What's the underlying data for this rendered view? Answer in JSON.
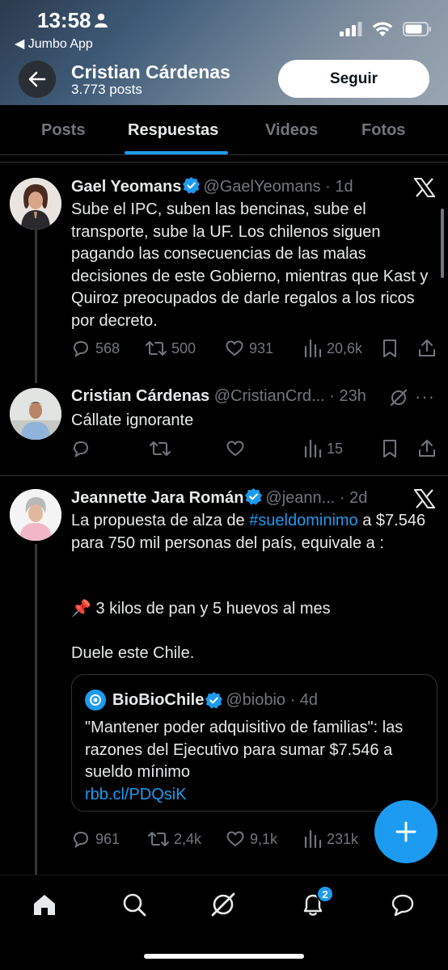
{
  "status_bar": {
    "time": "13:58",
    "back_app": "◀ Jumbo App"
  },
  "profile": {
    "name": "Cristian Cárdenas",
    "posts": "3.773 posts",
    "follow_label": "Seguir"
  },
  "tabs": [
    {
      "label": "Posts"
    },
    {
      "label": "Respuestas"
    },
    {
      "label": "Videos"
    },
    {
      "label": "Fotos"
    }
  ],
  "tweets": [
    {
      "name": "Gael Yeomans",
      "handle": "@GaelYeomans · 1d",
      "text": "Sube el IPC, suben las bencinas, sube el transporte, sube la UF. Los chilenos siguen pagando las consecuencias de las malas decisiones de este Gobierno, mientras que Kast y Quiroz preocupados de darle regalos a los ricos por decreto.",
      "replies": "568",
      "reposts": "500",
      "likes": "931",
      "views": "20,6k"
    },
    {
      "name": "Cristian Cárdenas",
      "handle": "@CristianCrd... · 23h",
      "text": "Cállate ignorante",
      "replies": "",
      "reposts": "",
      "likes": "",
      "views": "15"
    },
    {
      "name": "Jeannette Jara Román",
      "handle": "@jeann... · 2d",
      "text_before": "La propuesta de alza de ",
      "hashtag": "#sueldominimo",
      "text_after": " a $7.546 para 750 mil personas del país, equivale a :",
      "line2": "📌 3 kilos de pan y 5 huevos al mes",
      "line3": "Duele este Chile.",
      "replies": "961",
      "reposts": "2,4k",
      "likes": "9,1k",
      "views": "231k"
    }
  ],
  "quote": {
    "name": "BioBioChile",
    "handle": "@biobio · 4d",
    "text": "\"Mantener poder adquisitivo de familias\": las razones del Ejecutivo para sumar $7.546 a sueldo mínimo",
    "link": "rbb.cl/PDQsiK"
  },
  "notifications_badge": "2",
  "colors": {
    "accent": "#1d9bf0",
    "background": "#000000",
    "muted": "#71767b"
  }
}
